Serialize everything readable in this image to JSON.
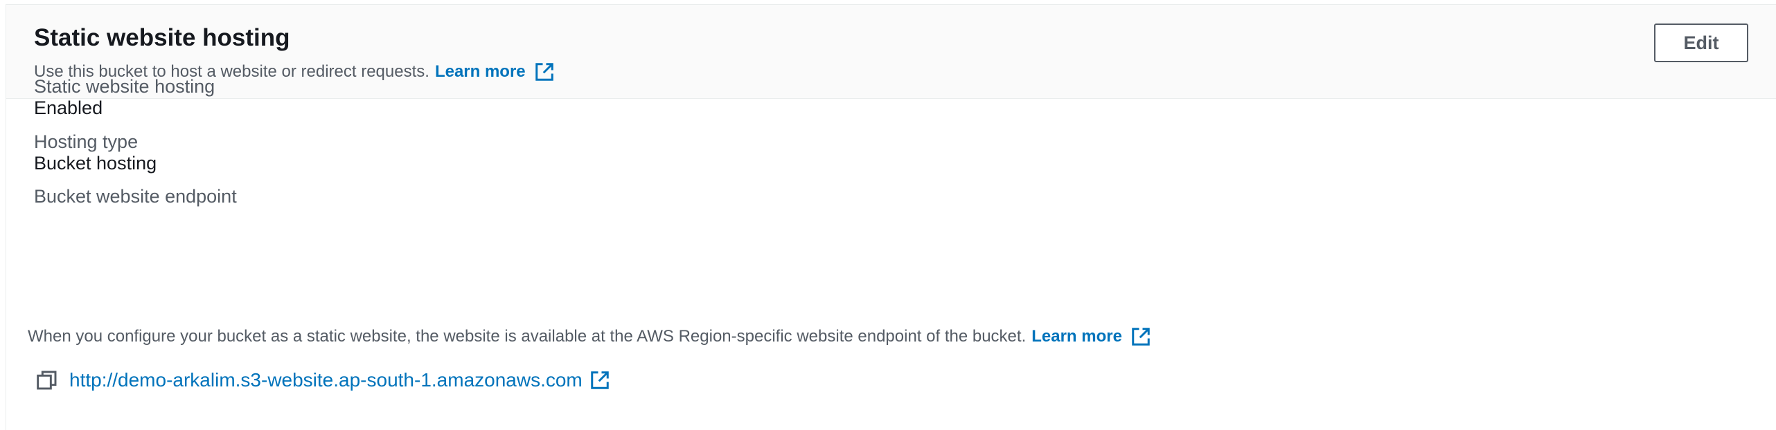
{
  "header": {
    "title": "Static website hosting",
    "description": "Use this bucket to host a website or redirect requests.",
    "learn_more": "Learn more",
    "edit_label": "Edit"
  },
  "fields": {
    "hosting": {
      "label": "Static website hosting",
      "value": "Enabled"
    },
    "hosting_type": {
      "label": "Hosting type",
      "value": "Bucket hosting"
    },
    "endpoint": {
      "label": "Bucket website endpoint",
      "description": "When you configure your bucket as a static website, the website is available at the AWS Region-specific website endpoint of the bucket.",
      "learn_more": "Learn more",
      "url": "http://demo-arkalim.s3-website.ap-south-1.amazonaws.com"
    }
  },
  "icons": {
    "external_link": "external-link-icon",
    "copy": "copy-icon"
  },
  "colors": {
    "link": "#0073bb",
    "title": "#16191f",
    "secondary_text": "#545b64",
    "header_bg": "#fafafa"
  }
}
